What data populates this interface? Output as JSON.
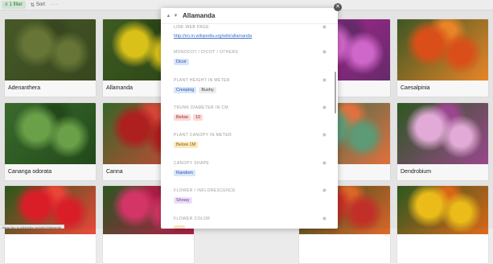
{
  "toolbar": {
    "filter_label": "1 filter",
    "sort_label": "Sort",
    "more_label": "···"
  },
  "gallery": {
    "cards": [
      {
        "name": "Adenanthera",
        "image": "green-foliage-photo",
        "colors": [
          "#4a5c2a",
          "#6b7a38",
          "#3a4a20"
        ]
      },
      {
        "name": "Allamanda",
        "image": "yellow-flowers-photo",
        "colors": [
          "#3f5e22",
          "#e0c81a",
          "#2e4818"
        ]
      },
      {
        "name": "",
        "image": "pink-bougainvillea-photo",
        "colors": [
          "#b32a9a",
          "#d66ad0",
          "#6a2b6d"
        ]
      },
      {
        "name": "Caesalpinia",
        "image": "orange-red-flowers-photo",
        "colors": [
          "#3f5a25",
          "#e2521a",
          "#f08a2a"
        ]
      },
      {
        "name": "Cananga odorata",
        "image": "green-leaves-photo",
        "colors": [
          "#3c6e2f",
          "#6ea64b",
          "#244b1c"
        ]
      },
      {
        "name": "Canna",
        "image": "red-canna-photo",
        "colors": [
          "#3a6a2a",
          "#b42020",
          "#d94a3a"
        ]
      },
      {
        "name": "",
        "image": "green-plant-photo",
        "colors": [
          "#2e6e55",
          "#5fa07a",
          "#e87540"
        ]
      },
      {
        "name": "Dendrobium",
        "image": "pink-orchid-photo",
        "colors": [
          "#2f5a22",
          "#e9b0de",
          "#a04a92"
        ]
      },
      {
        "name": "",
        "image": "red-hibiscus-photo",
        "colors": [
          "#2c5a1c",
          "#e21f2a",
          "#f04a3a"
        ]
      },
      {
        "name": "",
        "image": "pink-hibiscus-photo",
        "colors": [
          "#2f5a24",
          "#d9376a",
          "#b01f48"
        ]
      },
      {
        "name": "",
        "image": "red-bloom-photo",
        "colors": [
          "#314d22",
          "#c8322a",
          "#e26a2a"
        ]
      },
      {
        "name": "",
        "image": "yellow-orange-flowers-photo",
        "colors": [
          "#2f5a22",
          "#f2c21a",
          "#e06a1a"
        ]
      }
    ]
  },
  "status_url": "https://en.m.wikipedia.org/wiki/Allamanda",
  "panel": {
    "title": "Allamanda",
    "properties": [
      {
        "label": "LINK WEB PAGE",
        "link": "http://en.m.wikipedia.org/wiki/allamanda"
      },
      {
        "label": "MONOCOT / DICOT / OTHERS",
        "tags": [
          {
            "text": "Dicot",
            "color": "blue"
          }
        ]
      },
      {
        "label": "PLANT HEIGHT IN METER",
        "tags": [
          {
            "text": "Creeping",
            "color": "blue"
          },
          {
            "text": "Bushy",
            "color": "gray"
          }
        ]
      },
      {
        "label": "TRUNK DIAMETER IN CM",
        "tags": [
          {
            "text": "Below",
            "color": "red"
          },
          {
            "text": "10",
            "color": "red"
          }
        ]
      },
      {
        "label": "PLANT CANOPY IN METER",
        "tags": [
          {
            "text": "Below 1M",
            "color": "yellow"
          }
        ]
      },
      {
        "label": "CANOPY SHAPE",
        "tags": [
          {
            "text": "Random",
            "color": "blue"
          }
        ]
      },
      {
        "label": "FLOWER / INFLORESCENCE",
        "tags": [
          {
            "text": "Showy",
            "color": "purple"
          }
        ]
      },
      {
        "label": "FLOWER COLOR",
        "tags": [
          {
            "text": "",
            "color": "orange"
          }
        ]
      }
    ]
  },
  "icons": {
    "filter": "filter-icon",
    "sort": "sort-icon",
    "close": "close-icon",
    "eye": "eye-icon",
    "chev_up": "chevron-up-icon",
    "chev_down": "chevron-down-icon"
  }
}
